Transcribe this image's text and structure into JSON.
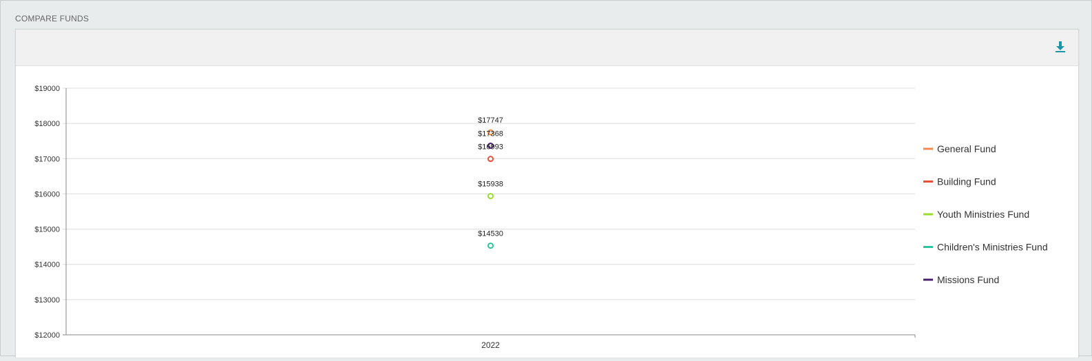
{
  "section": {
    "title": "COMPARE FUNDS"
  },
  "toolbar": {
    "download_icon": "download-icon"
  },
  "colors": {
    "General Fund": "#f08a4b",
    "Building Fund": "#e8503a",
    "Youth Ministries Fund": "#9bdc2e",
    "Children's Ministries Fund": "#2fc49e",
    "Missions Fund": "#4b1f6f",
    "accent": "#1a96a8"
  },
  "chart_data": {
    "type": "line",
    "x": [
      "2022"
    ],
    "ylim": [
      12000,
      19000
    ],
    "yticks": [
      12000,
      13000,
      14000,
      15000,
      16000,
      17000,
      18000,
      19000
    ],
    "ytick_labels": [
      "$12000",
      "$13000",
      "$14000",
      "$15000",
      "$16000",
      "$17000",
      "$18000",
      "$19000"
    ],
    "grid": true,
    "legend_position": "right",
    "series": [
      {
        "name": "General Fund",
        "values": [
          17747
        ],
        "label": "$17747"
      },
      {
        "name": "Building Fund",
        "values": [
          16993
        ],
        "label": "$16993"
      },
      {
        "name": "Youth Ministries Fund",
        "values": [
          15938
        ],
        "label": "$15938"
      },
      {
        "name": "Children's Ministries Fund",
        "values": [
          14530
        ],
        "label": "$14530"
      },
      {
        "name": "Missions Fund",
        "values": [
          17368
        ],
        "label": "$17368"
      }
    ]
  }
}
